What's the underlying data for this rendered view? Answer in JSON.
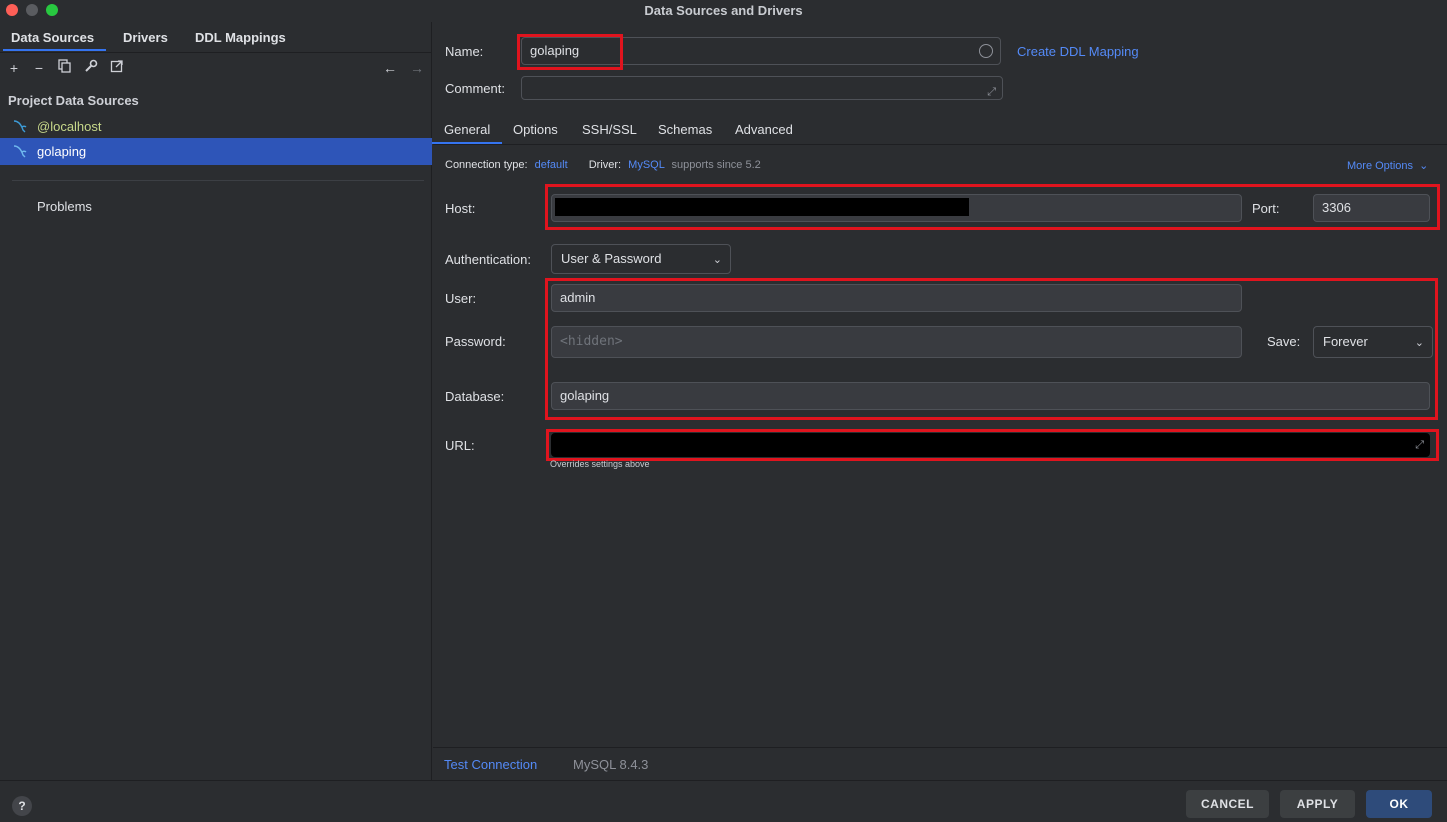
{
  "window": {
    "title": "Data Sources and Drivers"
  },
  "left": {
    "tabs": [
      "Data Sources",
      "Drivers",
      "DDL Mappings"
    ],
    "section_title": "Project Data Sources",
    "items": [
      {
        "label": "@localhost",
        "selected": false
      },
      {
        "label": "golaping",
        "selected": true
      }
    ],
    "problems_label": "Problems"
  },
  "form": {
    "name_label": "Name:",
    "name_value": "golaping",
    "create_ddl_link": "Create DDL Mapping",
    "comment_label": "Comment:",
    "tabs": [
      "General",
      "Options",
      "SSH/SSL",
      "Schemas",
      "Advanced"
    ],
    "connection_type_label": "Connection type:",
    "connection_type_value": "default",
    "driver_label": "Driver:",
    "driver_value": "MySQL",
    "driver_note": "supports since 5.2",
    "more_options": "More Options",
    "host_label": "Host:",
    "port_label": "Port:",
    "port_value": "3306",
    "auth_label": "Authentication:",
    "auth_value": "User & Password",
    "user_label": "User:",
    "user_value": "admin",
    "password_label": "Password:",
    "password_placeholder": "<hidden>",
    "save_label": "Save:",
    "save_value": "Forever",
    "database_label": "Database:",
    "database_value": "golaping",
    "url_label": "URL:",
    "url_note": "Overrides settings above"
  },
  "footer": {
    "test_connection": "Test Connection",
    "server_version": "MySQL 8.4.3"
  },
  "buttons": {
    "help": "?",
    "cancel": "CANCEL",
    "apply": "APPLY",
    "ok": "OK"
  },
  "colors": {
    "accent": "#3574f0",
    "link": "#548af7",
    "highlight": "#e0141e",
    "selection": "#2e55b8"
  }
}
